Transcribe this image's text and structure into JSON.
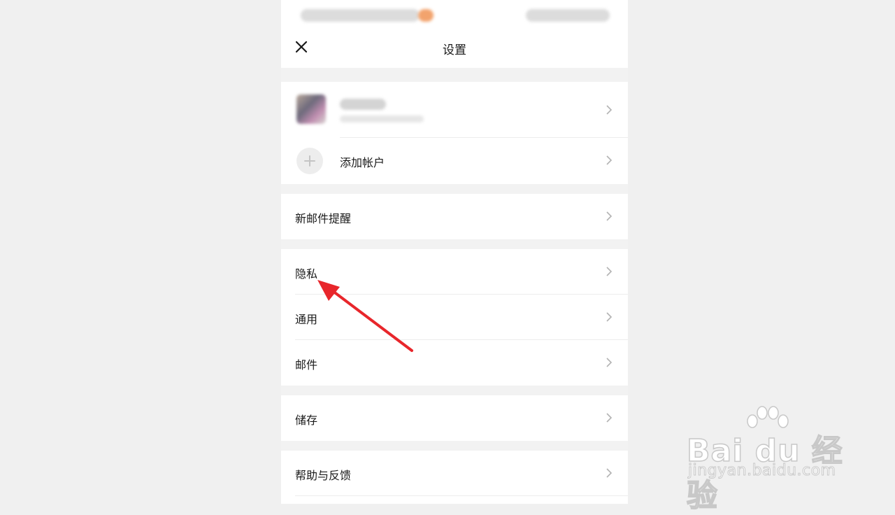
{
  "header": {
    "title": "设置",
    "close_icon": "close-icon"
  },
  "accounts": {
    "add_account_label": "添加帐户"
  },
  "groups": [
    {
      "items": [
        {
          "label": "新邮件提醒"
        }
      ]
    },
    {
      "items": [
        {
          "label": "隐私"
        },
        {
          "label": "通用"
        },
        {
          "label": "邮件"
        }
      ]
    },
    {
      "items": [
        {
          "label": "储存"
        }
      ]
    },
    {
      "items": [
        {
          "label": "帮助与反馈"
        }
      ]
    }
  ],
  "colors": {
    "annotation_arrow": "#e8262b",
    "background": "#f2f2f2",
    "card": "#ffffff"
  },
  "watermark": {
    "brand": "Bai du 经验",
    "url": "jingyan.baidu.com"
  }
}
